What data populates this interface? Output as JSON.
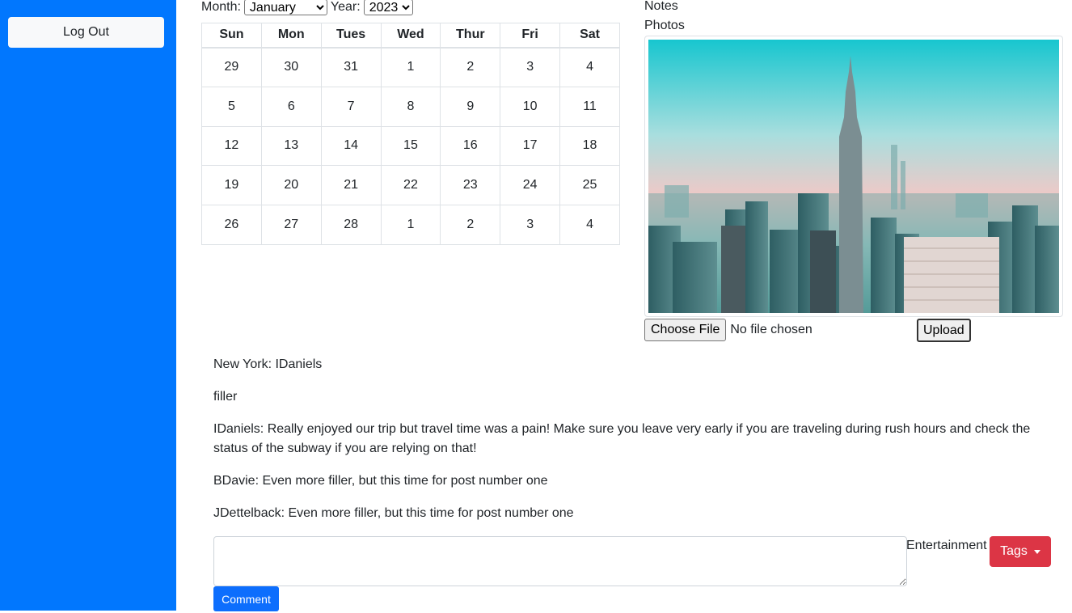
{
  "sidebar": {
    "logout_label": "Log Out"
  },
  "calendar": {
    "month_label": "Month:",
    "selected_month": "January",
    "year_label": "Year:",
    "selected_year": "2023",
    "weekdays": [
      "Sun",
      "Mon",
      "Tues",
      "Wed",
      "Thur",
      "Fri",
      "Sat"
    ],
    "weeks": [
      [
        "29",
        "30",
        "31",
        "1",
        "2",
        "3",
        "4"
      ],
      [
        "5",
        "6",
        "7",
        "8",
        "9",
        "10",
        "11"
      ],
      [
        "12",
        "13",
        "14",
        "15",
        "16",
        "17",
        "18"
      ],
      [
        "19",
        "20",
        "21",
        "22",
        "23",
        "24",
        "25"
      ],
      [
        "26",
        "27",
        "28",
        "1",
        "2",
        "3",
        "4"
      ]
    ]
  },
  "side_panel": {
    "notes_label": "Notes",
    "photos_label": "Photos",
    "choose_file_label": "Choose File",
    "no_file_text": "No file chosen",
    "upload_label": "Upload"
  },
  "post": {
    "title": "New York: IDaniels",
    "body": "filler",
    "comments": [
      "IDaniels: Really enjoyed our trip but travel time was a pain! Make sure you leave very early if you are traveling during rush hours and check the status of the subway if you are relying on that!",
      "BDavie: Even more filler, but this time for post number one",
      "JDettelback: Even more filler, but this time for post number one"
    ]
  },
  "comment_form": {
    "textarea_value": "",
    "category": "Entertainment",
    "tags_label": "Tags",
    "submit_label": "Comment"
  },
  "colors": {
    "sidebar": "#0177fe",
    "primary_button": "#0d6efd",
    "danger_button": "#dc3545"
  }
}
